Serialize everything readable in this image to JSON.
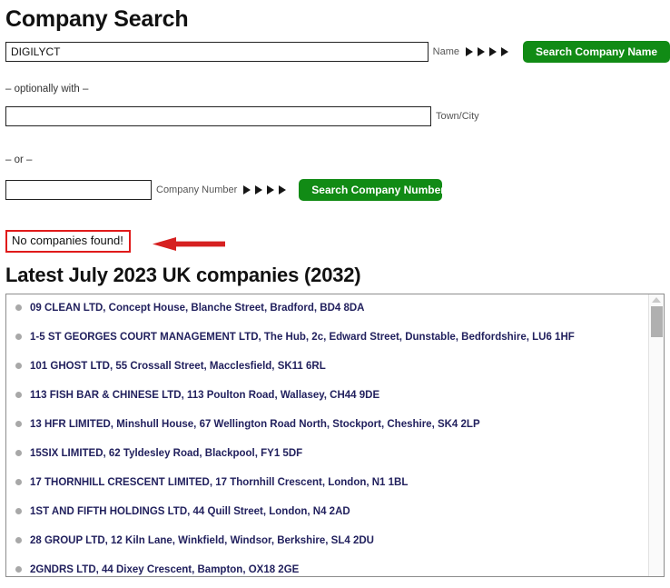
{
  "page": {
    "title": "Company Search"
  },
  "search": {
    "name_row": {
      "input_value": "DIGILYCT",
      "input_placeholder": "",
      "label": "Name",
      "button_label": "Search Company Name"
    },
    "separator_optionally": "– optionally with –",
    "town_row": {
      "input_value": "",
      "input_placeholder": "",
      "label": "Town/City"
    },
    "separator_or": "– or –",
    "number_row": {
      "input_value": "",
      "input_placeholder": "",
      "label": "Company Number",
      "button_label": "Search Company Number"
    }
  },
  "annotation": {
    "no_results_text": "No companies found!",
    "box_color": "#e01b1b",
    "arrow_color": "#d62020",
    "arrow_direction": "left"
  },
  "results": {
    "heading": "Latest July 2023 UK companies (2032)",
    "items": [
      "09 CLEAN LTD, Concept House, Blanche Street, Bradford, BD4 8DA",
      "1-5 ST GEORGES COURT MANAGEMENT LTD, The Hub, 2c, Edward Street, Dunstable, Bedfordshire, LU6 1HF",
      "101 GHOST LTD, 55 Crossall Street, Macclesfield, SK11 6RL",
      "113 FISH BAR & CHINESE LTD, 113 Poulton Road, Wallasey, CH44 9DE",
      "13 HFR LIMITED, Minshull House, 67 Wellington Road North, Stockport, Cheshire, SK4 2LP",
      "15SIX LIMITED, 62 Tyldesley Road, Blackpool, FY1 5DF",
      "17 THORNHILL CRESCENT LIMITED, 17 Thornhill Crescent, London, N1 1BL",
      "1ST AND FIFTH HOLDINGS LTD, 44 Quill Street, London, N4 2AD",
      "28 GROUP LTD, 12 Kiln Lane, Winkfield, Windsor, Berkshire, SL4 2DU",
      "2GNDRS LTD, 44 Dixey Crescent, Bampton, OX18 2GE"
    ],
    "link_color": "#22215e",
    "bullet_color": "#a8a8a8"
  },
  "theme": {
    "button_green": "#118b15"
  }
}
